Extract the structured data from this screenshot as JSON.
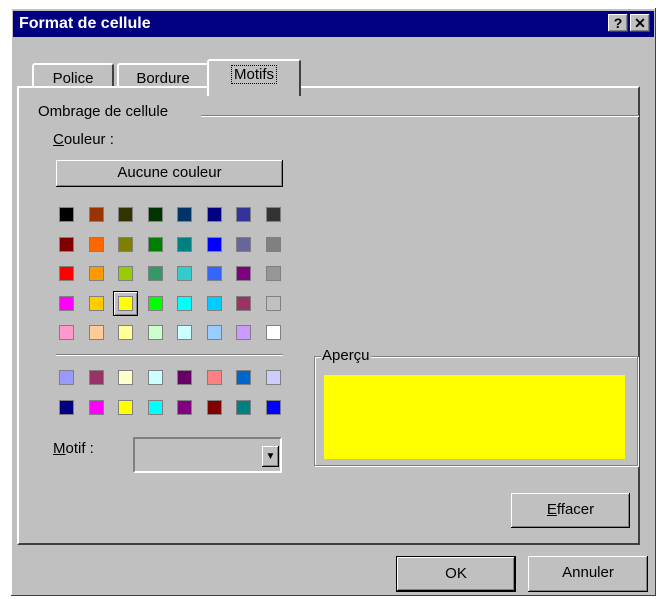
{
  "window": {
    "title": "Format de cellule",
    "help_label": "?",
    "close_label": "✕"
  },
  "tabs": [
    {
      "label": "Police"
    },
    {
      "label": "Bordure"
    },
    {
      "label": "Motifs",
      "active": true
    }
  ],
  "shading": {
    "section_label": "Ombrage de cellule",
    "color_label_accel": "C",
    "color_label_rest": "ouleur :",
    "no_color_label": "Aucune couleur",
    "selected_color": "#ffff00",
    "palette": [
      [
        "#000000",
        "#993300",
        "#333300",
        "#003300",
        "#003366",
        "#000080",
        "#333399",
        "#333333"
      ],
      [
        "#800000",
        "#ff6600",
        "#808000",
        "#008000",
        "#008080",
        "#0000ff",
        "#666699",
        "#808080"
      ],
      [
        "#ff0000",
        "#ff9900",
        "#99cc00",
        "#339966",
        "#33cccc",
        "#3366ff",
        "#800080",
        "#969696"
      ],
      [
        "#ff00ff",
        "#ffcc00",
        "#ffff00",
        "#00ff00",
        "#00ffff",
        "#00ccff",
        "#993366",
        "#c0c0c0"
      ],
      [
        "#ff99cc",
        "#ffcc99",
        "#ffff99",
        "#ccffcc",
        "#ccffff",
        "#99ccff",
        "#cc99ff",
        "#ffffff"
      ]
    ],
    "palette_extra": [
      [
        "#9999ff",
        "#993366",
        "#ffffcc",
        "#ccffff",
        "#660066",
        "#ff8080",
        "#0066cc",
        "#ccccff"
      ],
      [
        "#000080",
        "#ff00ff",
        "#ffff00",
        "#00ffff",
        "#800080",
        "#800000",
        "#008080",
        "#0000ff"
      ]
    ],
    "pattern_label_accel": "M",
    "pattern_label_rest": "otif :",
    "pattern_value": ""
  },
  "preview": {
    "label": "Aperçu",
    "color": "#ffff00"
  },
  "buttons": {
    "clear_accel": "E",
    "clear_rest": "ffacer",
    "ok_label": "OK",
    "cancel_label": "Annuler"
  }
}
